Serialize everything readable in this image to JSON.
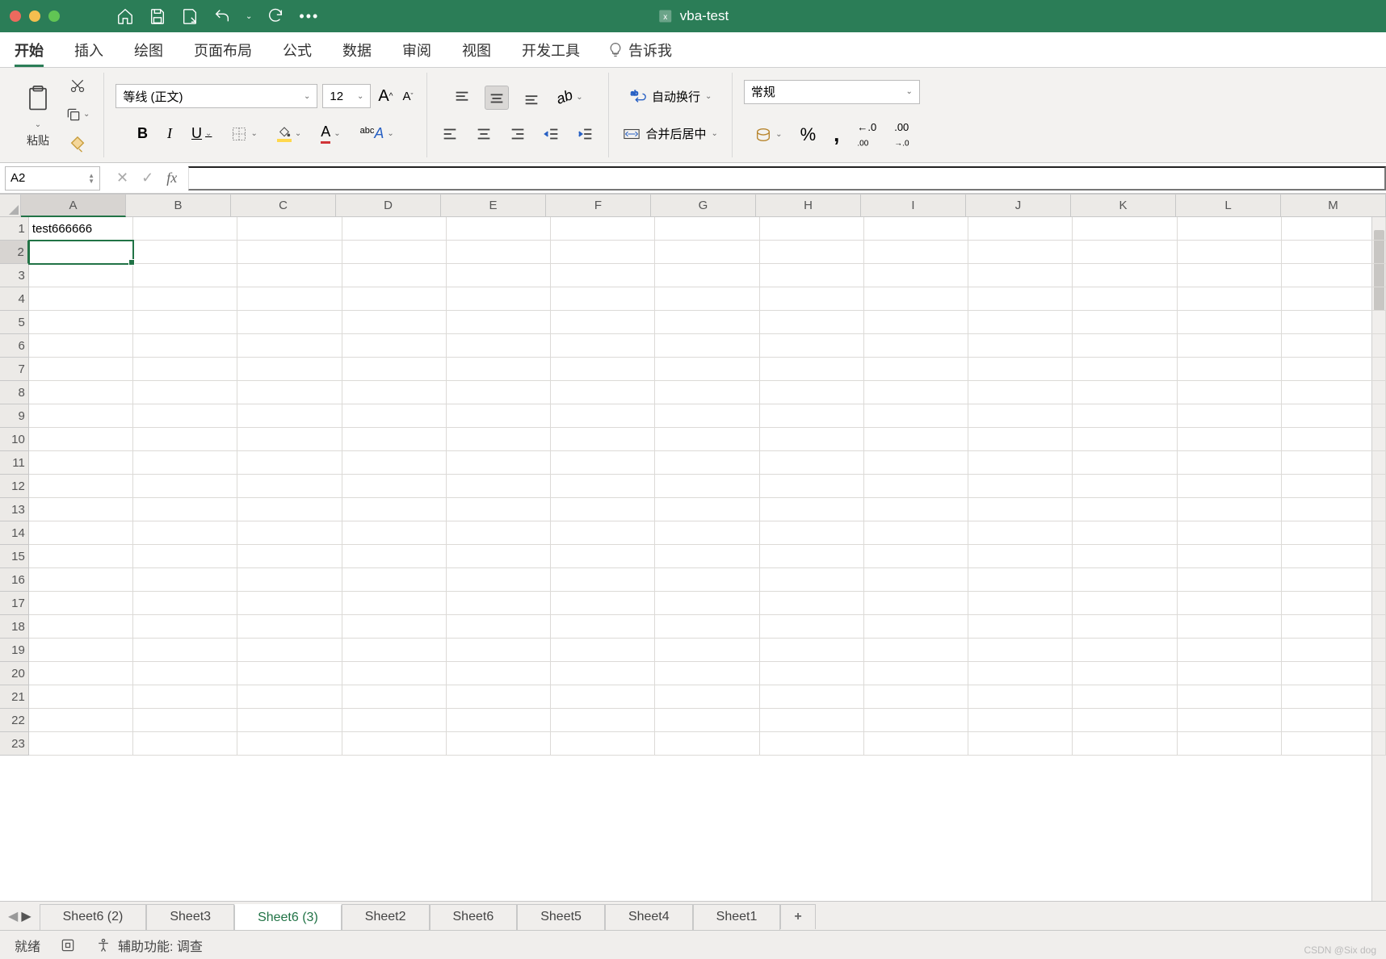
{
  "titlebar": {
    "filename": "vba-test"
  },
  "ribbon_tabs": [
    "开始",
    "插入",
    "绘图",
    "页面布局",
    "公式",
    "数据",
    "审阅",
    "视图",
    "开发工具"
  ],
  "tell_me": "告诉我",
  "ribbon": {
    "paste_label": "粘贴",
    "font_name": "等线 (正文)",
    "font_size": "12",
    "wrap_text": "自动换行",
    "merge_center": "合并后居中",
    "number_format": "常规"
  },
  "namebox": {
    "value": "A2"
  },
  "formula_bar": {
    "value": ""
  },
  "columns": [
    "A",
    "B",
    "C",
    "D",
    "E",
    "F",
    "G",
    "H",
    "I",
    "J",
    "K",
    "L",
    "M"
  ],
  "rows": 23,
  "cells": {
    "A1": "test666666"
  },
  "selected_cell": "A2",
  "sheets": [
    "Sheet6 (2)",
    "Sheet3",
    "Sheet6 (3)",
    "Sheet2",
    "Sheet6",
    "Sheet5",
    "Sheet4",
    "Sheet1"
  ],
  "active_sheet": "Sheet6 (3)",
  "status": {
    "ready": "就绪",
    "accessibility": "辅助功能: 调查"
  },
  "watermark": "CSDN @Six dog"
}
